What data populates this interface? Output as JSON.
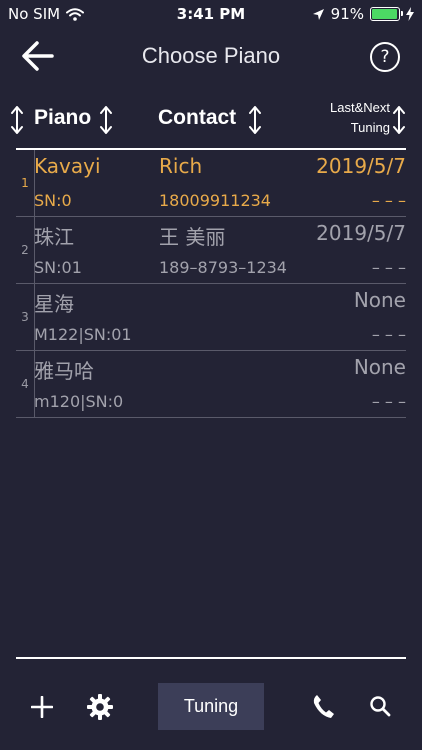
{
  "status_bar": {
    "carrier": "No SIM",
    "time": "3:41 PM",
    "battery_percent": "91%"
  },
  "nav": {
    "title": "Choose Piano",
    "help_glyph": "?"
  },
  "columns": {
    "piano": "Piano",
    "contact": "Contact",
    "last_line1": "Last&Next",
    "last_line2": "Tuning"
  },
  "rows": [
    {
      "index": "1",
      "name": "Kavayi",
      "sn": "SN:0",
      "contact": "Rich",
      "phone": "18009911234",
      "last": "2019/5/7",
      "next": "– – –",
      "selected": true
    },
    {
      "index": "2",
      "name": "珠江",
      "sn": "SN:01",
      "contact": "王 美丽",
      "phone": "189–8793–1234",
      "last": "2019/5/7",
      "next": "– – –",
      "selected": false
    },
    {
      "index": "3",
      "name": "星海",
      "sn": "M122|SN:01",
      "contact": "",
      "phone": "",
      "last": "None",
      "next": "– – –",
      "selected": false
    },
    {
      "index": "4",
      "name": "雅马哈",
      "sn": "m120|SN:0",
      "contact": "",
      "phone": "",
      "last": "None",
      "next": "– – –",
      "selected": false
    }
  ],
  "toolbar": {
    "tuning_label": "Tuning"
  },
  "colors": {
    "background": "#232335",
    "selected": "#e8aa4a",
    "muted": "#a2a2ac",
    "battery": "#4cd964",
    "button": "#3c3e58"
  }
}
